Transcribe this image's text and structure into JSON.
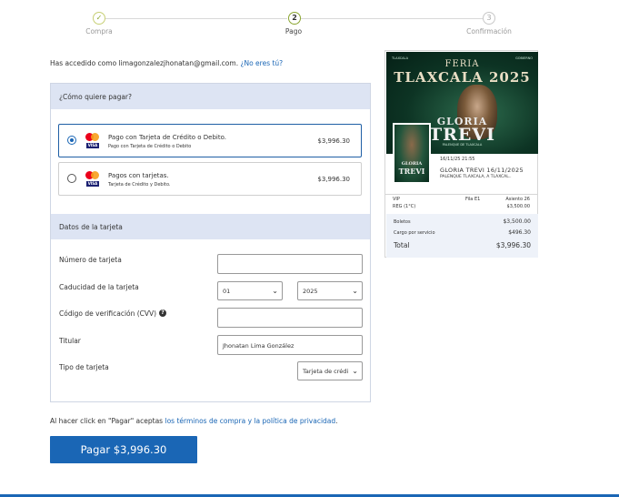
{
  "stepper": {
    "steps": [
      {
        "label": "Compra",
        "num": "✓"
      },
      {
        "label": "Pago",
        "num": "2"
      },
      {
        "label": "Confirmación",
        "num": "3"
      }
    ]
  },
  "account": {
    "prefix": "Has accedido como ",
    "email": "limagonzalezjhonatan@gmail.com",
    "suffix": ". ",
    "not_you": "¿No eres tú?"
  },
  "payment": {
    "heading": "¿Cómo quiere pagar?",
    "options": [
      {
        "title": "Pago con Tarjeta de Crédito o Debito.",
        "subtitle": "Pago con Tarjeta de Crédito o Debito",
        "amount": "$3,996.30",
        "selected": true
      },
      {
        "title": "Pagos con tarjetas.",
        "subtitle": "Tarjeta de Crédito y Debito.",
        "amount": "$3,996.30",
        "selected": false
      }
    ]
  },
  "card": {
    "heading": "Datos de la tarjeta",
    "number_label": "Número de tarjeta",
    "number_value": "",
    "expiry_label": "Caducidad de la tarjeta",
    "month_value": "01",
    "year_value": "2025",
    "cvv_label": "Código de verificación (CVV)",
    "cvv_value": "",
    "holder_label": "Titular",
    "holder_value": "Jhonatan Lima González",
    "type_label": "Tipo de tarjeta",
    "type_value": "Tarjeta de crédi"
  },
  "terms": {
    "prefix": "Al hacer click en \"Pagar\" aceptas ",
    "link": "los términos de compra y la política de privacidad",
    "suffix": "."
  },
  "pay_button": "Pagar $3,996.30",
  "event": {
    "poster_logos_left": "TLAXCALA",
    "poster_logos_right": "GOBIERNO",
    "poster_title1": "FERIA",
    "poster_title2": "TLAXCALA 2025",
    "poster_name1": "GLORIA",
    "poster_name2": "TREVI",
    "poster_sub": "PALENQUE DE TLAXCALA",
    "thumb_name1": "GLORIA",
    "thumb_name2": "TREVI",
    "date": "16/11/25 21:55",
    "name": "GLORIA TREVI 16/11/2025",
    "venue": "PALENQUE TLAXCALA, A TLAXCAL..",
    "ticket": {
      "section": "VIP",
      "zone": "REG (1°C)",
      "row": "Fila E1",
      "seat": "Asiento 26",
      "price": "$3,500.00"
    },
    "totals": {
      "tickets_label": "Boletos",
      "tickets_value": "$3,500.00",
      "fee_label": "Cargo por servicio",
      "fee_value": "$496.30",
      "total_label": "Total",
      "total_value": "$3,996.30"
    }
  },
  "colors": {
    "accent": "#1a66b5",
    "section_bg": "#dde4f3",
    "step_done": "#8aa531"
  }
}
